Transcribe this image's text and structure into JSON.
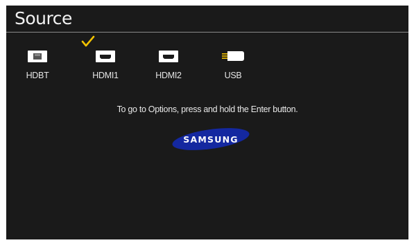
{
  "screen": {
    "title": "Source",
    "hint": "To go to Options, press and hold the Enter button.",
    "logo_text": "SAMSUNG",
    "colors": {
      "background": "#1a1a1a",
      "accent_check": "#f2c200",
      "usb_contacts": "#f2c200",
      "logo_blue": "#1428a0"
    }
  },
  "sources": [
    {
      "label": "HDBT",
      "icon": "hdbt-port-icon",
      "selected": false
    },
    {
      "label": "HDMI1",
      "icon": "hdmi-port-icon",
      "selected": true
    },
    {
      "label": "HDMI2",
      "icon": "hdmi-port-icon",
      "selected": false
    },
    {
      "label": "USB",
      "icon": "usb-drive-icon",
      "selected": false
    }
  ]
}
